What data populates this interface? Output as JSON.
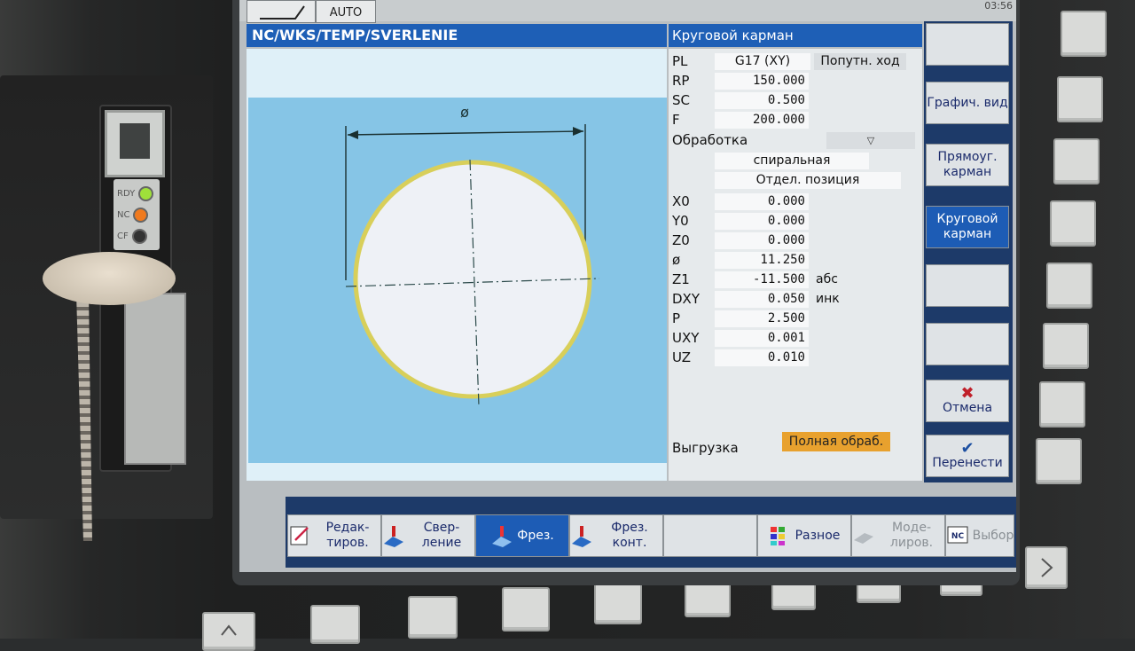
{
  "header": {
    "mode_label": "AUTO",
    "clock": "03:56",
    "path": "NC/WKS/TEMP/SVERLENIE",
    "form_title": "Круговой карман"
  },
  "hardware": {
    "leds": [
      "RDY",
      "NC",
      "CF"
    ]
  },
  "params": [
    {
      "label": "PL",
      "value": "G17 (XY)",
      "extra": "Попутн. ход"
    },
    {
      "label": "RP",
      "value": "150.000"
    },
    {
      "label": "SC",
      "value": "0.500"
    },
    {
      "label": "F",
      "value": "200.000"
    },
    {
      "label": "Обработка",
      "value": "▽"
    },
    {
      "label": "",
      "value": "спиральная"
    },
    {
      "label": "",
      "value": "Отдел. позиция"
    },
    {
      "label": "X0",
      "value": "0.000"
    },
    {
      "label": "Y0",
      "value": "0.000"
    },
    {
      "label": "Z0",
      "value": "0.000"
    },
    {
      "label": "ø",
      "value": "11.250"
    },
    {
      "label": "Z1",
      "value": "-11.500",
      "unit": "абс"
    },
    {
      "label": "DXY",
      "value": "0.050",
      "unit": "инк"
    },
    {
      "label": "P",
      "value": "2.500"
    },
    {
      "label": "UXY",
      "value": "0.001"
    },
    {
      "label": "UZ",
      "value": "0.010"
    }
  ],
  "unloading": {
    "label": "Выгрузка",
    "value": "Полная обраб."
  },
  "graphic": {
    "diameter_symbol": "ø"
  },
  "right_softkeys": [
    "",
    "Графич. вид",
    "Прямоуг. карман",
    "Круговой карман",
    "",
    "",
    "Отмена",
    "Перенести"
  ],
  "bottom_softkeys": [
    {
      "label": "Редак- тиров.",
      "icon": "edit-icon"
    },
    {
      "label": "Свер- ление",
      "icon": "drilling-icon"
    },
    {
      "label": "Фрез.",
      "icon": "milling-icon"
    },
    {
      "label": "Фрез. конт.",
      "icon": "contour-milling-icon"
    },
    {
      "label": "",
      "icon": ""
    },
    {
      "label": "Разное",
      "icon": "misc-icon"
    },
    {
      "label": "Моде- лиров.",
      "icon": "simulation-icon"
    },
    {
      "label": "Выбор",
      "icon": "nc-select-icon"
    }
  ],
  "colors": {
    "accent_blue": "#1e5fb6",
    "graphic_blue": "#86c5e6",
    "highlight_orange": "#e8a12e",
    "cancel_red": "#c0202a",
    "contour_yellow": "#d8cf5a"
  }
}
